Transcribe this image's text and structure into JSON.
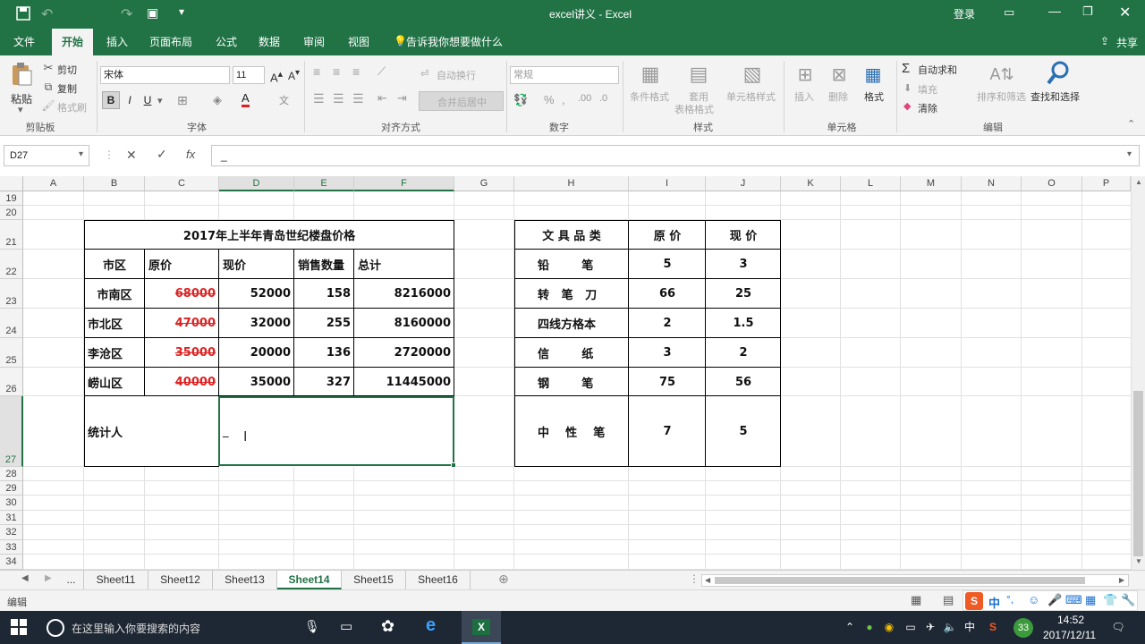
{
  "window": {
    "title": "excel讲义  -  Excel",
    "login": "登录",
    "share": "共享"
  },
  "tabs": [
    "文件",
    "开始",
    "插入",
    "页面布局",
    "公式",
    "数据",
    "审阅",
    "视图"
  ],
  "tell_me": "告诉我你想要做什么",
  "ribbon": {
    "clipboard": {
      "paste": "粘贴",
      "cut": "剪切",
      "copy": "复制",
      "format_painter": "格式刷",
      "label": "剪贴板"
    },
    "font": {
      "name": "宋体",
      "size": "11",
      "label": "字体",
      "bold": "B",
      "italic": "I",
      "underline": "U"
    },
    "align": {
      "wrap": "自动换行",
      "merge": "合并后居中",
      "label": "对齐方式"
    },
    "number": {
      "format": "常规",
      "label": "数字"
    },
    "styles": {
      "cond": "条件格式",
      "table1": "套用",
      "table2": "表格格式",
      "cell": "单元格样式",
      "label": "样式"
    },
    "cells": {
      "insert": "插入",
      "delete": "删除",
      "format": "格式",
      "label": "单元格"
    },
    "edit": {
      "autosum": "自动求和",
      "fill": "填充",
      "clear": "清除",
      "sort": "排序和筛选",
      "find": "查找和选择",
      "label": "编辑"
    }
  },
  "formula_bar": {
    "name_box": "D27",
    "content": "_"
  },
  "columns": [
    "A",
    "B",
    "C",
    "D",
    "E",
    "F",
    "G",
    "H",
    "I",
    "J",
    "K",
    "L",
    "M",
    "N",
    "O",
    "P"
  ],
  "rows": [
    "19",
    "20",
    "21",
    "22",
    "23",
    "24",
    "25",
    "26",
    "27",
    "28",
    "29",
    "30",
    "31",
    "32",
    "33",
    "34"
  ],
  "table1": {
    "title": "2017年上半年青岛世纪楼盘价格",
    "headers": [
      "市区",
      "原价",
      "现价",
      "销售数量",
      "总计"
    ],
    "rows": [
      {
        "district": "市南区",
        "orig": "68000",
        "now": "52000",
        "qty": "158",
        "total": "8216000"
      },
      {
        "district": "市北区",
        "orig": "47000",
        "now": "32000",
        "qty": "255",
        "total": "8160000"
      },
      {
        "district": "李沧区",
        "orig": "35000",
        "now": "20000",
        "qty": "136",
        "total": "2720000"
      },
      {
        "district": "崂山区",
        "orig": "40000",
        "now": "35000",
        "qty": "327",
        "total": "11445000"
      }
    ],
    "footer_label": "统计人",
    "footer_value": "_"
  },
  "table2": {
    "headers": [
      "文 具 品 类",
      "原 价",
      "现 价"
    ],
    "rows": [
      {
        "name": "铅        笔",
        "orig": "5",
        "now": "3"
      },
      {
        "name": "转   笔   刀",
        "orig": "66",
        "now": "25"
      },
      {
        "name": "四线方格本",
        "orig": "2",
        "now": "1.5"
      },
      {
        "name": "信        纸",
        "orig": "3",
        "now": "2"
      },
      {
        "name": "钢        笔",
        "orig": "75",
        "now": "56"
      },
      {
        "name": "中    性    笔",
        "orig": "7",
        "now": "5"
      }
    ]
  },
  "sheets": [
    "...",
    "Sheet11",
    "Sheet12",
    "Sheet13",
    "Sheet14",
    "Sheet15",
    "Sheet16"
  ],
  "active_sheet": "Sheet14",
  "status": {
    "mode": "编辑"
  },
  "taskbar": {
    "search": "在这里输入你要搜索的内容",
    "time": "14:52",
    "date": "2017/12/11",
    "ime": "中",
    "badge": "33"
  },
  "colors": {
    "excel_green": "#217346",
    "strike_red": "#dd2222",
    "taskbar": "#1e2834"
  }
}
